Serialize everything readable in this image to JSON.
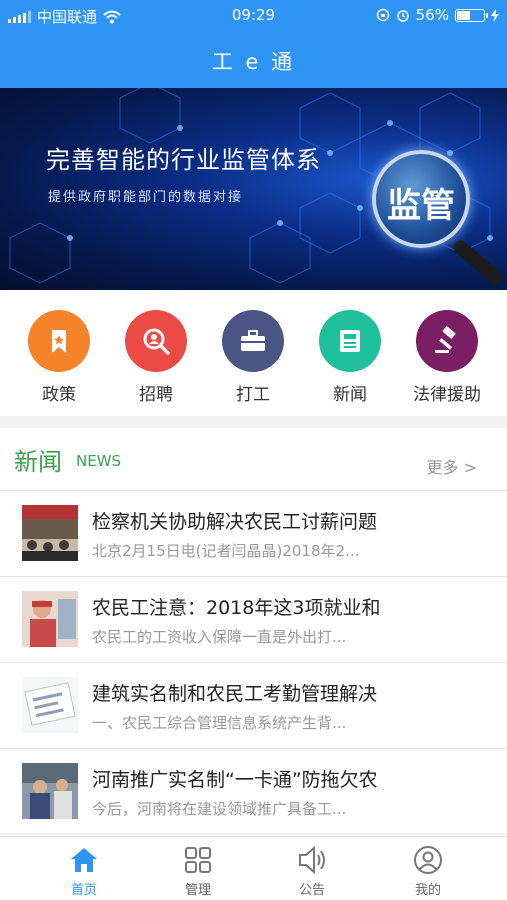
{
  "status_bar": {
    "carrier": "中国联通",
    "time": "09:29",
    "battery": "56%",
    "battery_level": 0.56
  },
  "header": {
    "title": "工 e 通"
  },
  "banner": {
    "headline": "完善智能的行业监管体系",
    "subline": "提供政府职能部门的数据对接",
    "badge": "监管"
  },
  "categories": [
    {
      "label": "政策",
      "icon": "bookmark-icon",
      "color": "#f5832b"
    },
    {
      "label": "招聘",
      "icon": "search-person-icon",
      "color": "#ec4a44"
    },
    {
      "label": "打工",
      "icon": "briefcase-icon",
      "color": "#4b5585"
    },
    {
      "label": "新闻",
      "icon": "newspaper-icon",
      "color": "#1fbf9e"
    },
    {
      "label": "法律援助",
      "icon": "gavel-icon",
      "color": "#7a1f63"
    }
  ],
  "news": {
    "title": "新闻",
    "title_en": "NEWS",
    "more": "更多 >",
    "items": [
      {
        "title": "检察机关协助解决农民工讨薪问题",
        "summary": "北京2月15日电(记者闫晶晶)2018年2..."
      },
      {
        "title": "农民工注意：2018年这3项就业和",
        "summary": "农民工的工资收入保障一直是外出打..."
      },
      {
        "title": "建筑实名制和农民工考勤管理解决",
        "summary": "一、农民工综合管理信息系统产生背..."
      },
      {
        "title": "河南推广实名制“一卡通”防拖欠农",
        "summary": "今后，河南将在建设领域推广具备工..."
      }
    ]
  },
  "tabbar": {
    "items": [
      {
        "label": "首页",
        "icon": "home-icon",
        "active": true
      },
      {
        "label": "管理",
        "icon": "grid-icon",
        "active": false
      },
      {
        "label": "公告",
        "icon": "speaker-icon",
        "active": false
      },
      {
        "label": "我的",
        "icon": "user-icon",
        "active": false
      }
    ],
    "active_color": "#2f95f5"
  }
}
